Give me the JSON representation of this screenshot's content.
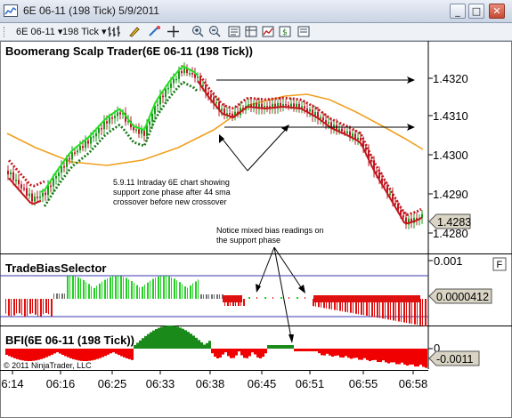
{
  "window": {
    "title": "6E 06-11 (198 Tick)  5/9/2011",
    "minimize_glyph": "_",
    "maximize_glyph": "□",
    "close_glyph": "✕"
  },
  "toolbar": {
    "instrument": "6E 06-11",
    "interval": "198 Tick",
    "icons": [
      "bar-style-icon",
      "pencil-icon",
      "draw-tools-icon",
      "crosshair-icon",
      "zoom-in-icon",
      "zoom-out-icon",
      "properties-icon",
      "data-box-icon",
      "strategy-icon",
      "indicator-icon"
    ]
  },
  "price_panel": {
    "title": "Boomerang Scalp Trader(6E 06-11 (198 Tick))",
    "y_ticks": [
      "1.4320",
      "1.4310",
      "1.4300",
      "1.4290",
      "1.4280"
    ],
    "last_price": "1.4283",
    "annotation_1": [
      "5.9.11 Intraday 6E chart showing",
      "support zone phase after 44 sma",
      "crossover before new crossover"
    ],
    "annotation_2": [
      "Notice mixed bias readings on",
      "the support phase"
    ]
  },
  "bias_panel": {
    "title": "TradeBiasSelector",
    "y_tick": "0.001",
    "value": "0.0000412",
    "f_label": "F"
  },
  "bfi_panel": {
    "title": "BFI(6E 06-11 (198 Tick))",
    "y_tick": "0",
    "value": "-0.0011",
    "copyright": "© 2011 NinjaTrader, LLC"
  },
  "x_axis": {
    "labels": [
      "6:14",
      "06:16",
      "06:25",
      "06:33",
      "06:38",
      "06:45",
      "06:51",
      "06:55",
      "06:58"
    ]
  },
  "colors": {
    "up_bar": "#1a9a1a",
    "down_bar": "#c0182a",
    "sma": "#f0a020",
    "bias_green": "#22d022",
    "bias_red": "#e01010",
    "bias_gray": "#707070",
    "bfi_green": "#1a8a1a",
    "bfi_red": "#f00000"
  }
}
